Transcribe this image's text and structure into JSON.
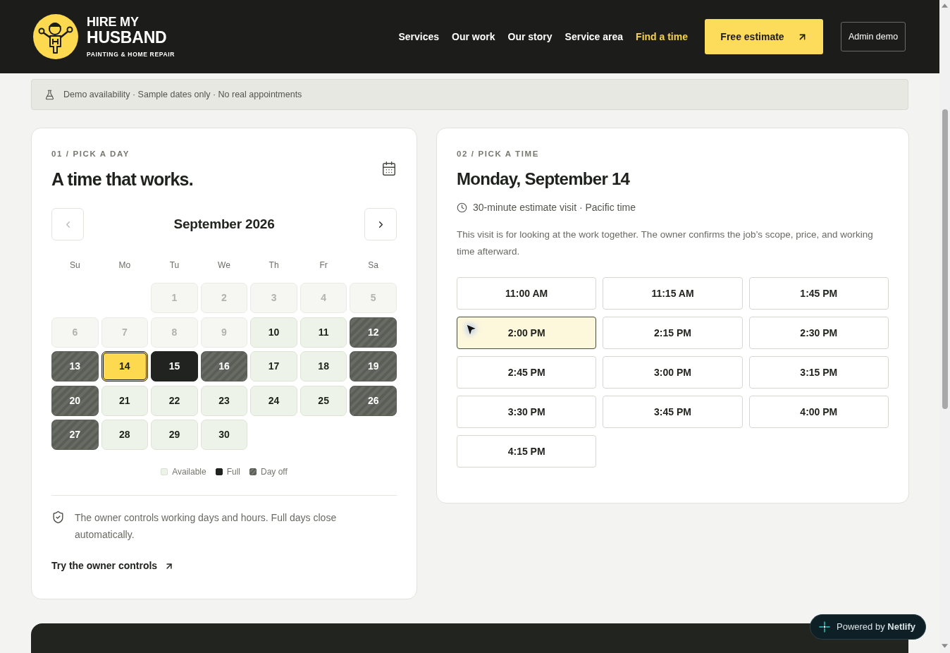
{
  "header": {
    "brand": {
      "line1": "HIRE MY",
      "line2": "HUSBAND",
      "tagline": "PAINTING & HOME REPAIR"
    },
    "nav": [
      {
        "label": "Services",
        "selected": false
      },
      {
        "label": "Our work",
        "selected": false
      },
      {
        "label": "Our story",
        "selected": false
      },
      {
        "label": "Service area",
        "selected": false
      },
      {
        "label": "Find a time",
        "selected": true
      }
    ],
    "cta": "Free estimate",
    "admin": "Admin demo"
  },
  "notice": "Demo availability · Sample dates only · No real appointments",
  "day_picker": {
    "step": "01 / PICK A DAY",
    "title": "A time that works.",
    "month": "September 2026",
    "month_nav": {
      "prev_disabled": true,
      "next_disabled": false
    },
    "weekdays": [
      "Su",
      "Mo",
      "Tu",
      "We",
      "Th",
      "Fr",
      "Sa"
    ],
    "weeks": [
      [
        {
          "day": "1",
          "kind": "past",
          "selected": false
        },
        {
          "day": "2",
          "kind": "past",
          "selected": false
        },
        {
          "day": "3",
          "kind": "past",
          "selected": false
        },
        {
          "day": "4",
          "kind": "past",
          "selected": false
        },
        {
          "day": "5",
          "kind": "past",
          "selected": false
        }
      ],
      [
        {
          "day": "6",
          "kind": "past",
          "selected": false
        },
        {
          "day": "7",
          "kind": "past",
          "selected": false
        },
        {
          "day": "8",
          "kind": "past",
          "selected": false
        },
        {
          "day": "9",
          "kind": "past",
          "selected": false
        },
        {
          "day": "10",
          "kind": "available",
          "selected": false
        },
        {
          "day": "11",
          "kind": "available",
          "selected": false
        },
        {
          "day": "12",
          "kind": "day_off",
          "selected": false
        }
      ],
      [
        {
          "day": "13",
          "kind": "day_off",
          "selected": false
        },
        {
          "day": "14",
          "kind": "available",
          "selected": true
        },
        {
          "day": "15",
          "kind": "full",
          "selected": false
        },
        {
          "day": "16",
          "kind": "day_off",
          "selected": false
        },
        {
          "day": "17",
          "kind": "available",
          "selected": false
        },
        {
          "day": "18",
          "kind": "available",
          "selected": false
        },
        {
          "day": "19",
          "kind": "day_off",
          "selected": false
        }
      ],
      [
        {
          "day": "20",
          "kind": "day_off",
          "selected": false
        },
        {
          "day": "21",
          "kind": "available",
          "selected": false
        },
        {
          "day": "22",
          "kind": "available",
          "selected": false
        },
        {
          "day": "23",
          "kind": "available",
          "selected": false
        },
        {
          "day": "24",
          "kind": "available",
          "selected": false
        },
        {
          "day": "25",
          "kind": "available",
          "selected": false
        },
        {
          "day": "26",
          "kind": "day_off",
          "selected": false
        }
      ],
      [
        {
          "day": "27",
          "kind": "day_off",
          "selected": false
        },
        {
          "day": "28",
          "kind": "available",
          "selected": false
        },
        {
          "day": "29",
          "kind": "available",
          "selected": false
        },
        {
          "day": "30",
          "kind": "available",
          "selected": false
        }
      ]
    ],
    "legend": [
      {
        "kind": "available",
        "label": "Available"
      },
      {
        "kind": "full",
        "label": "Full"
      },
      {
        "kind": "day_off",
        "label": "Day off"
      }
    ],
    "note": "The owner controls working days and hours. Full days close automatically.",
    "link": "Try the owner controls"
  },
  "time_picker": {
    "step": "02 / PICK A TIME",
    "title": "Monday, September 14",
    "meta": "30-minute estimate visit · Pacific time",
    "description": "This visit is for looking at the work together. The owner confirms the job’s scope, price, and working time afterward.",
    "slots": [
      {
        "label": "11:00 AM",
        "selected": false
      },
      {
        "label": "11:15 AM",
        "selected": false
      },
      {
        "label": "1:45 PM",
        "selected": false
      },
      {
        "label": "2:00 PM",
        "selected": true
      },
      {
        "label": "2:15 PM",
        "selected": false
      },
      {
        "label": "2:30 PM",
        "selected": false
      },
      {
        "label": "2:45 PM",
        "selected": false
      },
      {
        "label": "3:00 PM",
        "selected": false
      },
      {
        "label": "3:15 PM",
        "selected": false
      },
      {
        "label": "3:30 PM",
        "selected": false
      },
      {
        "label": "3:45 PM",
        "selected": false
      },
      {
        "label": "4:00 PM",
        "selected": false
      },
      {
        "label": "4:15 PM",
        "selected": false
      }
    ]
  },
  "badge": {
    "text": "Powered by **Netlify**"
  }
}
